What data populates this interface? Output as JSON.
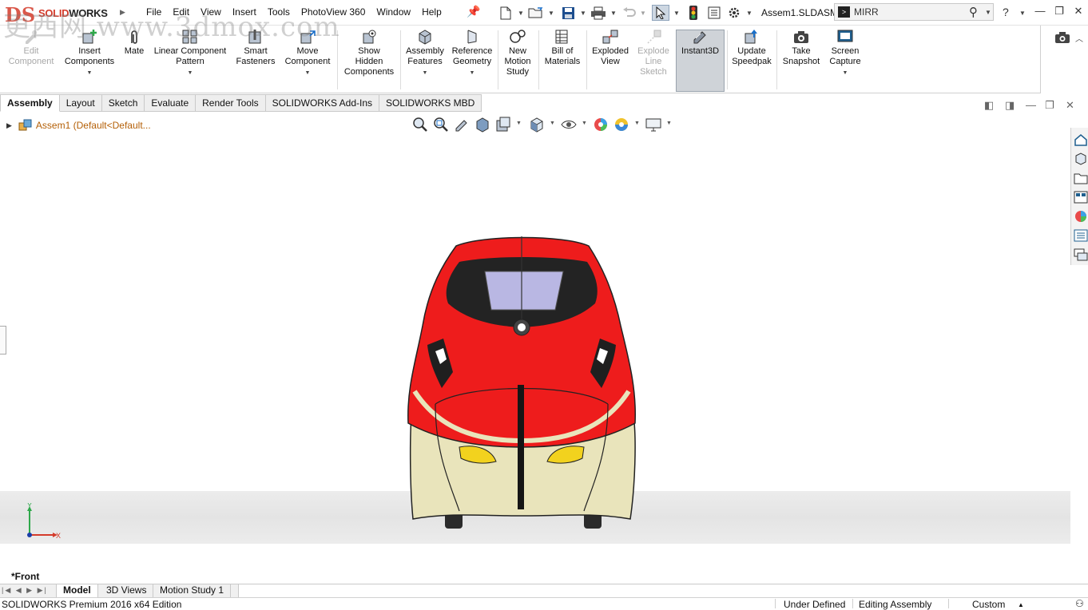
{
  "app": {
    "brand_prefix": "DS",
    "brand_name_a": "SOLID",
    "brand_name_b": "WORKS",
    "document_title": "Assem1.SLDASM",
    "watermark": "更西网 www.3dmox.com"
  },
  "menu": [
    "File",
    "Edit",
    "View",
    "Insert",
    "Tools",
    "PhotoView 360",
    "Window",
    "Help"
  ],
  "search": {
    "value": "MIRR",
    "cmd_glyph": ">"
  },
  "command_manager": {
    "tools": [
      {
        "label_1": "Edit",
        "label_2": "Component",
        "label_3": ""
      },
      {
        "label_1": "Insert",
        "label_2": "Components",
        "label_3": ""
      },
      {
        "label_1": "Mate",
        "label_2": "",
        "label_3": ""
      },
      {
        "label_1": "Linear Component",
        "label_2": "Pattern",
        "label_3": ""
      },
      {
        "label_1": "Smart",
        "label_2": "Fasteners",
        "label_3": ""
      },
      {
        "label_1": "Move",
        "label_2": "Component",
        "label_3": ""
      },
      {
        "label_1": "Show",
        "label_2": "Hidden",
        "label_3": "Components"
      },
      {
        "label_1": "Assembly",
        "label_2": "Features",
        "label_3": ""
      },
      {
        "label_1": "Reference",
        "label_2": "Geometry",
        "label_3": ""
      },
      {
        "label_1": "New",
        "label_2": "Motion",
        "label_3": "Study"
      },
      {
        "label_1": "Bill of",
        "label_2": "Materials",
        "label_3": ""
      },
      {
        "label_1": "Exploded",
        "label_2": "View",
        "label_3": ""
      },
      {
        "label_1": "Explode",
        "label_2": "Line",
        "label_3": "Sketch"
      },
      {
        "label_1": "Instant3D",
        "label_2": "",
        "label_3": ""
      },
      {
        "label_1": "Update",
        "label_2": "Speedpak",
        "label_3": ""
      },
      {
        "label_1": "Take",
        "label_2": "Snapshot",
        "label_3": ""
      },
      {
        "label_1": "Screen",
        "label_2": "Capture",
        "label_3": ""
      }
    ]
  },
  "tabs": [
    "Assembly",
    "Layout",
    "Sketch",
    "Evaluate",
    "Render Tools",
    "SOLIDWORKS Add-Ins",
    "SOLIDWORKS MBD"
  ],
  "tree": {
    "root": "Assem1  (Default<Default..."
  },
  "view": {
    "name": "*Front",
    "triad_y": "Y",
    "triad_x": "X"
  },
  "bottom_tabs": [
    "Model",
    "3D Views",
    "Motion Study 1"
  ],
  "status": {
    "edition": "SOLIDWORKS Premium 2016 x64 Edition",
    "definition": "Under Defined",
    "mode": "Editing Assembly",
    "units": "Custom"
  },
  "colors": {
    "accent": "#d43b2b",
    "train_red": "#ee1c1c",
    "train_cream": "#e9e4bb",
    "train_light": "#f2d21e",
    "window": "#b9b7e3"
  }
}
